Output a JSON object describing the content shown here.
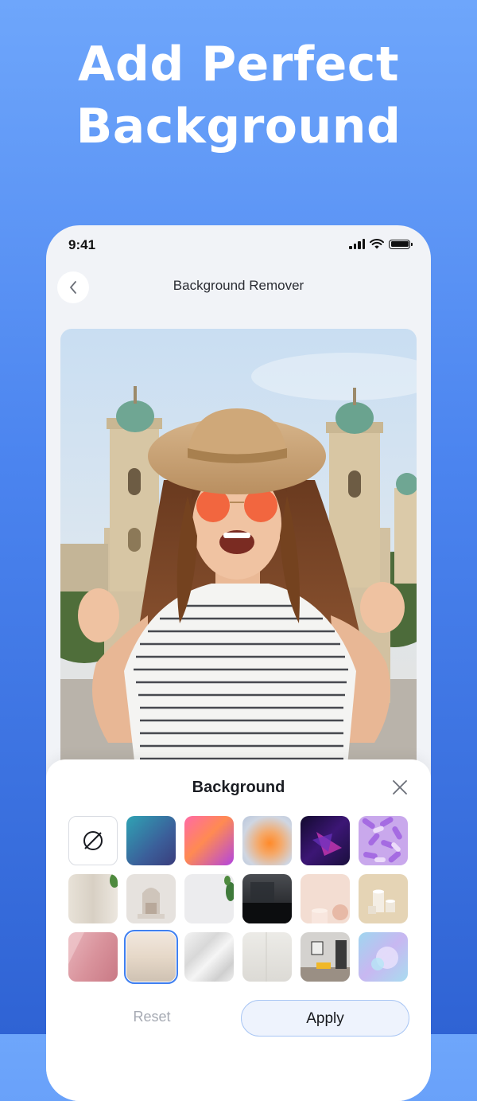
{
  "headline": {
    "line1": "Add Perfect",
    "line2": "Background"
  },
  "status_bar": {
    "time": "9:41"
  },
  "nav": {
    "title": "Background Remover",
    "back_icon": "chevron-left-icon"
  },
  "photo": {
    "subject": "woman in sun hat and red sunglasses in front of church towers"
  },
  "sheet": {
    "title": "Background",
    "close_icon": "close-icon",
    "swatches": [
      {
        "name": "none-swatch",
        "icon": "no-background-icon"
      },
      {
        "name": "teal-gradient-swatch"
      },
      {
        "name": "pink-orange-gradient-swatch"
      },
      {
        "name": "blur-orange-swatch"
      },
      {
        "name": "purple-abstract-swatch"
      },
      {
        "name": "lilac-capsules-swatch"
      },
      {
        "name": "wood-plant-swatch"
      },
      {
        "name": "arch-niche-swatch"
      },
      {
        "name": "light-grey-plant-swatch"
      },
      {
        "name": "dark-studio-swatch"
      },
      {
        "name": "peach-pedestal-swatch"
      },
      {
        "name": "beige-cylinders-swatch"
      },
      {
        "name": "rose-terrazzo-swatch"
      },
      {
        "name": "cream-gradient-swatch",
        "selected": true
      },
      {
        "name": "white-silk-swatch"
      },
      {
        "name": "light-wall-swatch"
      },
      {
        "name": "room-interior-swatch"
      },
      {
        "name": "holographic-swatch"
      }
    ],
    "reset_label": "Reset",
    "apply_label": "Apply"
  },
  "colors": {
    "accent": "#3f7ff0",
    "bg_top": "#6ea6fb",
    "bg_bottom": "#2f63d4"
  }
}
